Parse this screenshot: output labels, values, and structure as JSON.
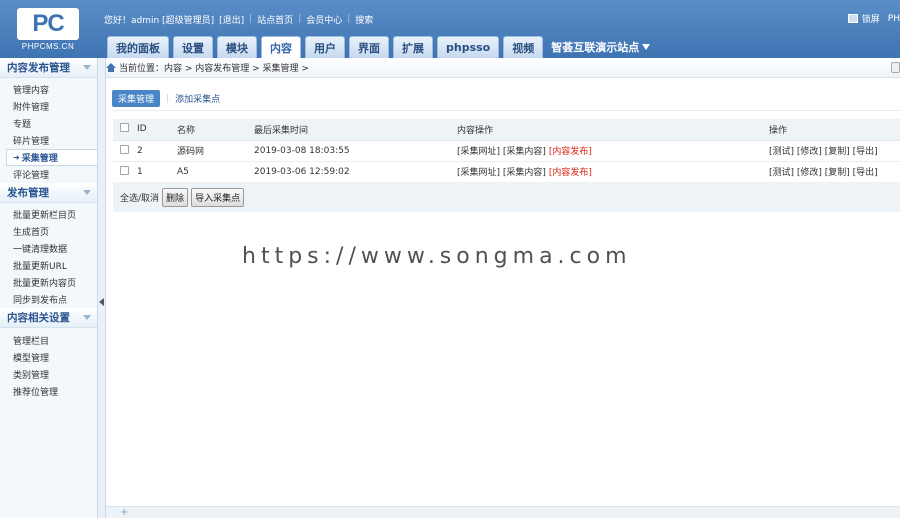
{
  "header": {
    "logo_mark": "PC",
    "logo_text": "PHPCMS.CN",
    "greeting": "您好！admin [超级管理员]",
    "logout": "[退出]",
    "site_home": "站点首页",
    "member_center": "会员中心",
    "search": "搜索",
    "lock_label": "锁屏",
    "right_cut": "PH"
  },
  "nav": {
    "tabs": [
      "我的面板",
      "设置",
      "模块",
      "内容",
      "用户",
      "界面",
      "扩展",
      "phpsso",
      "视频"
    ],
    "active_index": 3,
    "site_selector": "智荟互联演示站点"
  },
  "sidebar": {
    "groups": [
      {
        "title": "内容发布管理",
        "items": [
          "管理内容",
          "附件管理",
          "专题",
          "碎片管理",
          "采集管理",
          "评论管理"
        ],
        "active_item": 4
      },
      {
        "title": "发布管理",
        "items": [
          "批量更新栏目页",
          "生成首页",
          "一键清理数据",
          "批量更新URL",
          "批量更新内容页",
          "同步到发布点"
        ]
      },
      {
        "title": "内容相关设置",
        "items": [
          "管理栏目",
          "模型管理",
          "类别管理",
          "推荐位管理"
        ]
      }
    ]
  },
  "breadcrumb": "当前位置：内容 > 内容发布管理 > 采集管理 >",
  "subtabs": {
    "active": "采集管理",
    "link": "添加采集点"
  },
  "table": {
    "headers": [
      "ID",
      "名称",
      "最后采集时间",
      "内容操作",
      "操作"
    ],
    "rows": [
      {
        "id": "2",
        "name": "源码网",
        "time": "2019-03-08 18:03:55",
        "ops": [
          "[采集网址]",
          "[采集内容]",
          "[内容发布]"
        ],
        "actions": "[测试] [修改] [复制] [导出]"
      },
      {
        "id": "1",
        "name": "A5",
        "time": "2019-03-06 12:59:02",
        "ops": [
          "[采集网址]",
          "[采集内容]",
          "[内容发布]"
        ],
        "actions": "[测试] [修改] [复制] [导出]"
      }
    ]
  },
  "footer": {
    "select_all": "全选/取消",
    "delete": "删除",
    "import": "导入采集点"
  },
  "watermark": "https://www.songma.com",
  "colors": {
    "header_blue": "#3f74b3",
    "accent_red": "#dd2211"
  }
}
